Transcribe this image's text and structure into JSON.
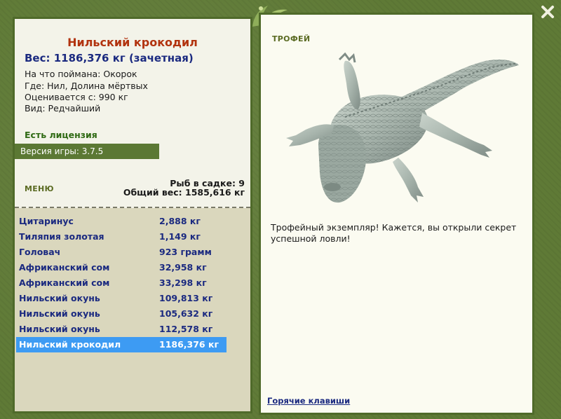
{
  "fish": {
    "title": "Нильский крокодил",
    "weight_line": "Вес: 1186,376 кг (зачетная)",
    "details": [
      "На что поймана: Окорок",
      "Где: Нил, Долина мёртвых",
      "Оценивается с: 990 кг",
      "Вид: Редчайший"
    ],
    "license": "Есть лицензия"
  },
  "version": "Версия игры: 3.7.5",
  "menu": {
    "label": "МЕНЮ",
    "keepnet_count": "Рыб в садке: 9",
    "keepnet_weight": "Общий вес: 1585,616 кг"
  },
  "catch_list": [
    {
      "name": "Цитаринус",
      "weight": "2,888 кг"
    },
    {
      "name": "Тиляпия золотая",
      "weight": "1,149 кг"
    },
    {
      "name": "Головач",
      "weight": "923 грамм"
    },
    {
      "name": "Африканский сом",
      "weight": "32,958 кг"
    },
    {
      "name": "Африканский сом",
      "weight": "33,298 кг"
    },
    {
      "name": "Нильский окунь",
      "weight": "109,813 кг"
    },
    {
      "name": "Нильский окунь",
      "weight": "105,632 кг"
    },
    {
      "name": "Нильский окунь",
      "weight": "112,578 кг"
    },
    {
      "name": "Нильский крокодил",
      "weight": "1186,376 кг",
      "selected": true
    }
  ],
  "trophy": {
    "label": "ТРОФЕЙ",
    "description": "Трофейный экземпляр! Кажется, вы открыли секрет успешной ловли!",
    "hotkeys_link": "Горячие клавиши"
  },
  "icons": {
    "close": "close-icon",
    "logo": "leaf-logo-icon",
    "trophy_image": "crocodile-image"
  },
  "colors": {
    "frame_green": "#5f7a36",
    "title_red": "#b2330f",
    "text_blue": "#1b2a80",
    "selection_blue": "#3d9bf3",
    "license_green": "#2f6a14"
  }
}
